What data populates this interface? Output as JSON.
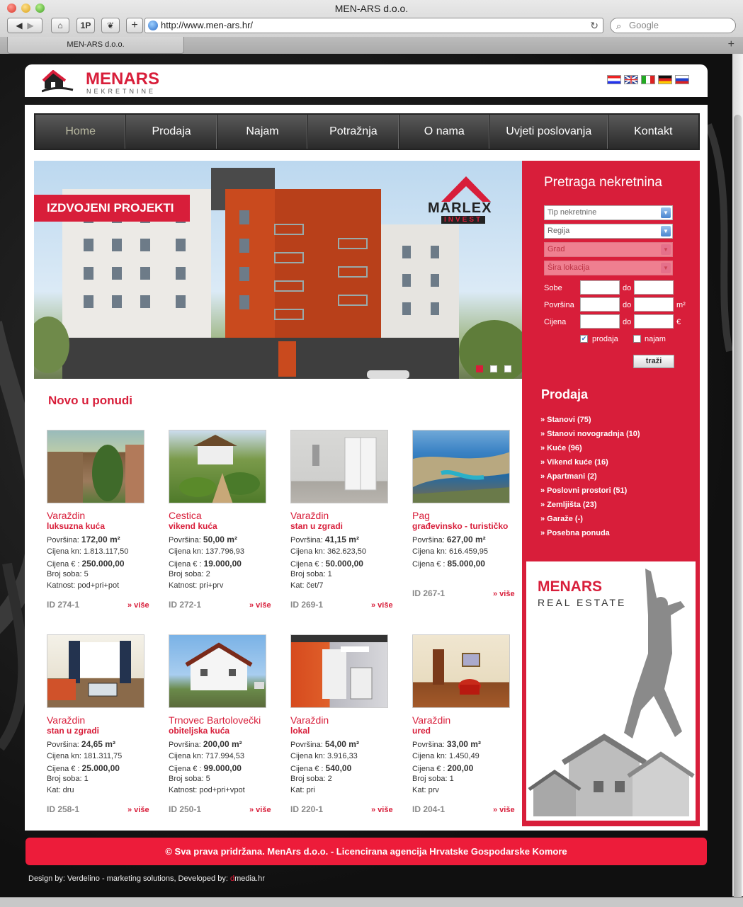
{
  "browser": {
    "window_title": "MEN-ARS d.o.o.",
    "url": "http://www.men-ars.hr/",
    "search_placeholder": "Google",
    "tab_title": "MEN-ARS d.o.o.",
    "btn_1p": "1P"
  },
  "header": {
    "logo_name": "MENARS",
    "logo_sub": "NEKRETNINE"
  },
  "nav": [
    {
      "label": "Home",
      "active": true
    },
    {
      "label": "Prodaja"
    },
    {
      "label": "Najam"
    },
    {
      "label": "Potražnja"
    },
    {
      "label": "O nama"
    },
    {
      "label": "Uvjeti poslovanja"
    },
    {
      "label": "Kontakt"
    }
  ],
  "hero": {
    "badge": "IZDVOJENI PROJEKTI",
    "brand": "MARLEX",
    "brand_sub": "INVEST"
  },
  "search": {
    "title": "Pretraga nekretnina",
    "selects": [
      "Tip nekretnine",
      "Regija",
      "Grad",
      "Šira lokacija"
    ],
    "sobe": "Sobe",
    "povrsina": "Površina",
    "cijena": "Cijena",
    "do": "do",
    "unit_area": "m²",
    "unit_price": "€",
    "prodaja": "prodaja",
    "najam": "najam",
    "button": "traži"
  },
  "prodaja": {
    "title": "Prodaja",
    "items": [
      "» Stanovi (75)",
      "» Stanovi novogradnja (10)",
      "» Kuće (96)",
      "» Vikend kuće (16)",
      "» Apartmani (2)",
      "» Poslovni prostori (51)",
      "» Zemljišta (23)",
      "» Garaže (-)",
      "» Posebna ponuda"
    ]
  },
  "banner": {
    "name": "MENARS",
    "sub": "REAL ESTATE"
  },
  "listings_title": "Novo u ponudi",
  "listings": [
    {
      "city": "Varaždin",
      "type": "luksuzna kuća",
      "area_label": "Površina:",
      "area": "172,00 m²",
      "kn_label": "Cijena kn:",
      "kn": "1.813.117,50",
      "eur_label": "Cijena € :",
      "eur": "250.000,00",
      "rooms": "Broj soba: 5",
      "extra": "Katnost: pod+pri+pot",
      "id": "ID 274-1",
      "more": "» više"
    },
    {
      "city": "Cestica",
      "type": "vikend kuća",
      "area_label": "Površina:",
      "area": "50,00 m²",
      "kn_label": "Cijena kn:",
      "kn": "137.796,93",
      "eur_label": "Cijena € :",
      "eur": "19.000,00",
      "rooms": "Broj soba: 2",
      "extra": "Katnost: pri+prv",
      "id": "ID 272-1",
      "more": "» više"
    },
    {
      "city": "Varaždin",
      "type": "stan u zgradi",
      "area_label": "Površina:",
      "area": "41,15 m²",
      "kn_label": "Cijena kn:",
      "kn": "362.623,50",
      "eur_label": "Cijena € :",
      "eur": "50.000,00",
      "rooms": "Broj soba: 1",
      "extra": "Kat: čet/7",
      "id": "ID 269-1",
      "more": "» više"
    },
    {
      "city": "Pag",
      "type": "građevinsko - turističko",
      "area_label": "Površina:",
      "area": "627,00 m²",
      "kn_label": "Cijena kn:",
      "kn": "616.459,95",
      "eur_label": "Cijena € :",
      "eur": "85.000,00",
      "rooms": "",
      "extra": "",
      "id": "ID 267-1",
      "more": "» više"
    },
    {
      "city": "Varaždin",
      "type": "stan u zgradi",
      "area_label": "Površina:",
      "area": "24,65 m²",
      "kn_label": "Cijena kn:",
      "kn": "181.311,75",
      "eur_label": "Cijena € :",
      "eur": "25.000,00",
      "rooms": "Broj soba: 1",
      "extra": "Kat: dru",
      "id": "ID 258-1",
      "more": "» više"
    },
    {
      "city": "Trnovec Bartolovečki",
      "type": "obiteljska kuća",
      "area_label": "Površina:",
      "area": "200,00 m²",
      "kn_label": "Cijena kn:",
      "kn": "717.994,53",
      "eur_label": "Cijena € :",
      "eur": "99.000,00",
      "rooms": "Broj soba: 5",
      "extra": "Katnost: pod+pri+vpot",
      "id": "ID 250-1",
      "more": "» više"
    },
    {
      "city": "Varaždin",
      "type": "lokal",
      "area_label": "Površina:",
      "area": "54,00 m²",
      "kn_label": "Cijena kn:",
      "kn": "3.916,33",
      "eur_label": "Cijena € :",
      "eur": "540,00",
      "rooms": "Broj soba: 2",
      "extra": "Kat: pri",
      "id": "ID 220-1",
      "more": "» više"
    },
    {
      "city": "Varaždin",
      "type": "ured",
      "area_label": "Površina:",
      "area": "33,00 m²",
      "kn_label": "Cijena kn:",
      "kn": "1.450,49",
      "eur_label": "Cijena € :",
      "eur": "200,00",
      "rooms": "Broj soba: 1",
      "extra": "Kat: prv",
      "id": "ID 204-1",
      "more": "» više"
    }
  ],
  "footer": {
    "copyright": "© Sva prava pridržana. MenArs d.o.o. - Licencirana agencija Hrvatske Gospodarske Komore",
    "design": "Design by: Verdelino - marketing solutions,  Developed by: ",
    "dev_mark": "d",
    "dev_name": "media.hr"
  },
  "colors": {
    "brand_red": "#d81e3a",
    "footer_red": "#ed1c3a",
    "nav_dark": "#2a2a2a"
  }
}
